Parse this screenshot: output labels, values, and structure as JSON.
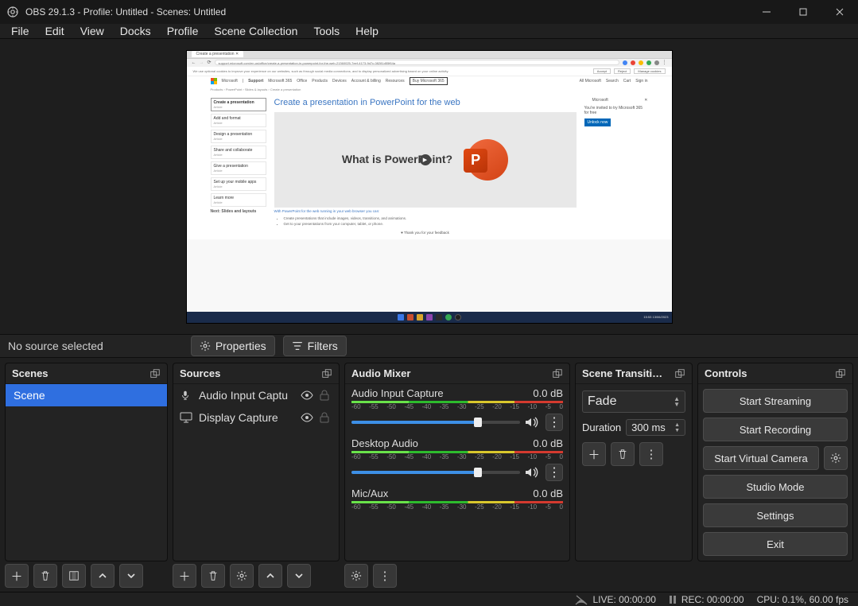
{
  "title": "OBS 29.1.3 - Profile: Untitled - Scenes: Untitled",
  "menu": [
    "File",
    "Edit",
    "View",
    "Docks",
    "Profile",
    "Scene Collection",
    "Tools",
    "Help"
  ],
  "midbar": {
    "status": "No source selected",
    "properties": "Properties",
    "filters": "Filters"
  },
  "panels": {
    "scenes": {
      "title": "Scenes",
      "items": [
        "Scene"
      ]
    },
    "sources": {
      "title": "Sources",
      "items": [
        {
          "icon": "mic",
          "name": "Audio Input Captu",
          "visible": true,
          "locked": true
        },
        {
          "icon": "display",
          "name": "Display Capture",
          "visible": true,
          "locked": true
        }
      ]
    },
    "mixer": {
      "title": "Audio Mixer",
      "ticks": [
        "-60",
        "-55",
        "-50",
        "-45",
        "-40",
        "-35",
        "-30",
        "-25",
        "-20",
        "-15",
        "-10",
        "-5",
        "0"
      ],
      "channels": [
        {
          "name": "Audio Input Capture",
          "db": "0.0 dB",
          "slider": 75
        },
        {
          "name": "Desktop Audio",
          "db": "0.0 dB",
          "slider": 75
        },
        {
          "name": "Mic/Aux",
          "db": "0.0 dB",
          "slider": 75
        }
      ]
    },
    "transitions": {
      "title": "Scene Transiti…",
      "value": "Fade",
      "duration_label": "Duration",
      "duration": "300 ms"
    },
    "controls": {
      "title": "Controls",
      "buttons": [
        "Start Streaming",
        "Start Recording",
        "Start Virtual Camera",
        "Studio Mode",
        "Settings",
        "Exit"
      ]
    }
  },
  "status": {
    "live": "LIVE: 00:00:00",
    "rec": "REC: 00:00:00",
    "cpu": "CPU: 0.1%, 60.00 fps"
  },
  "preview": {
    "tab": "Create a presentation ✕",
    "url": "support.microsoft.com/en-us/office/create-a-presentation-in-powerpoint-for-the-web-21360025-7eef-4173-9d7c-08281d55f64a",
    "cookie_msg": "We use optional cookies to improve your experience on our websites, such as through social media connections, and to display personalized advertising based on your online activity.",
    "cookie_btns": [
      "Accept",
      "Reject",
      "Manage cookies"
    ],
    "ms_links": [
      "Microsoft",
      "|",
      "Support",
      "Microsoft 365",
      "Office",
      "Products",
      "Devices",
      "Account & billing",
      "Resources"
    ],
    "ms_buy": "Buy Microsoft 365",
    "ms_right": [
      "All Microsoft",
      "Search",
      "Cart",
      "Sign in"
    ],
    "crumb": "Products › PowerPoint › Slides & layouts › Create a presentation",
    "side": [
      {
        "t": "Create a presentation",
        "s": "Article"
      },
      {
        "t": "Add and format",
        "s": "Article"
      },
      {
        "t": "Design a presentation",
        "s": "Article"
      },
      {
        "t": "Share and collaborate",
        "s": "Article"
      },
      {
        "t": "Give a presentation",
        "s": "Article"
      },
      {
        "t": "Set up your mobile apps",
        "s": "Article"
      },
      {
        "t": "Learn more",
        "s": "Article"
      }
    ],
    "side_more": "Next: Slides and layouts",
    "headline": "Create a presentation in PowerPoint for the web",
    "hero": "What is PowerPoint?",
    "intro": "With PowerPoint for the web running in your web browser you can:",
    "bullets": [
      "Create presentations that include images, videos, transitions, and animations.",
      "Get to your presentations from your computer, tablet, or phone."
    ],
    "thank": "♥ Thank you for your feedback",
    "right_panel": {
      "logo": "Microsoft",
      "invite": "You're invited to try Microsoft 365 for free",
      "cta": "Unlock now"
    },
    "task_time": "15:53\n13/06/2023"
  }
}
